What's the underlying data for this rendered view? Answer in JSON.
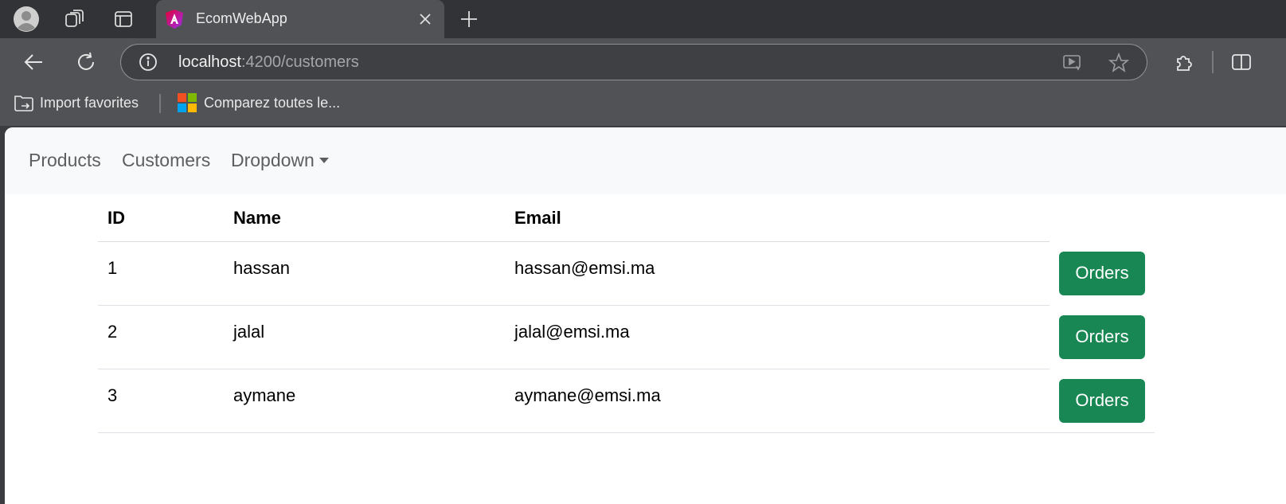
{
  "browser": {
    "tab": {
      "title": "EcomWebApp"
    },
    "address_bar": {
      "host": "localhost",
      "rest": ":4200/customers"
    },
    "favorites": [
      {
        "label": "Import favorites",
        "icon": "folder-import-icon"
      },
      {
        "label": "Comparez toutes le...",
        "icon": "microsoft-logo-icon"
      }
    ]
  },
  "navbar": {
    "links": [
      "Products",
      "Customers",
      "Dropdown"
    ]
  },
  "table": {
    "headers": {
      "id": "ID",
      "name": "Name",
      "email": "Email"
    },
    "rows": [
      {
        "id": "1",
        "name": "hassan",
        "email": "hassan@emsi.ma",
        "action": "Orders"
      },
      {
        "id": "2",
        "name": "jalal",
        "email": "jalal@emsi.ma",
        "action": "Orders"
      },
      {
        "id": "3",
        "name": "aymane",
        "email": "aymane@emsi.ma",
        "action": "Orders"
      }
    ]
  },
  "colors": {
    "button": "#198754",
    "navbar_bg": "#f8f9fa",
    "toolbar_bg": "#515256",
    "tabstrip_bg": "#323336"
  }
}
